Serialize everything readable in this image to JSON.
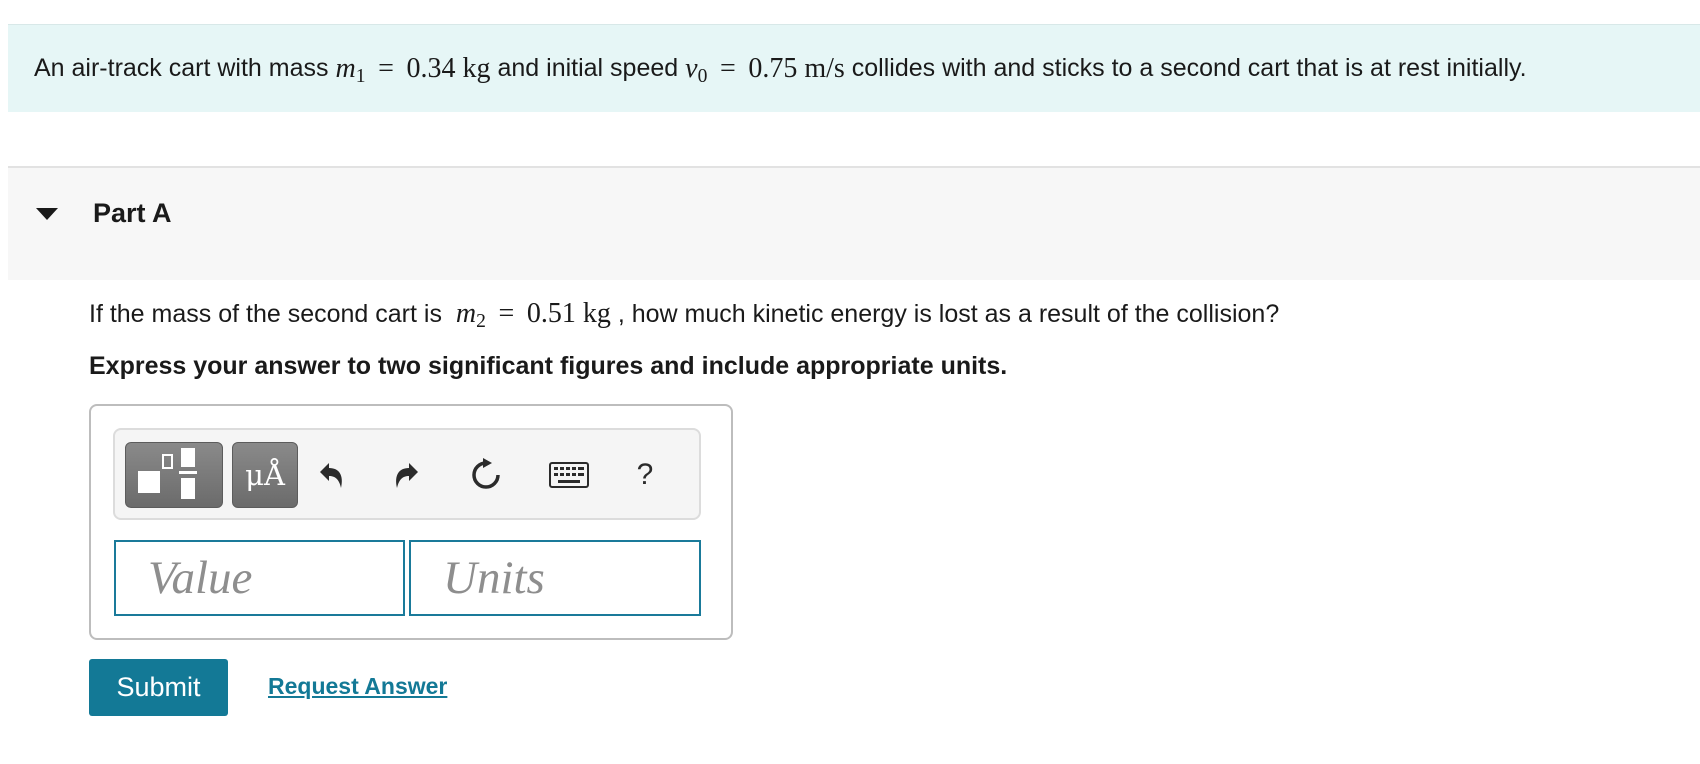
{
  "problem": {
    "intro_before_m1": "An air-track cart with mass ",
    "m1_symbol": "m",
    "m1_subscript": "1",
    "m1_value": "0.34 kg",
    "intro_mid": " and initial speed ",
    "v0_symbol": "v",
    "v0_subscript": "0",
    "v0_value": "0.75 m/s",
    "intro_after": " collides with and sticks to a second cart that is at rest initially."
  },
  "part": {
    "title": "Part A",
    "question_before": "If the mass of the second cart is ",
    "m2_symbol": "m",
    "m2_subscript": "2",
    "m2_value": "0.51 kg",
    "question_after": ", how much kinetic energy is lost as a result of the collision?",
    "instruction": "Express your answer to two significant figures and include appropriate units."
  },
  "math_common": {
    "equals": "="
  },
  "toolbar": {
    "symbols_label": "μÅ",
    "help_label": "?",
    "icons": [
      "templates-icon",
      "undo-icon",
      "redo-icon",
      "reset-icon",
      "keyboard-icon",
      "help-icon"
    ]
  },
  "answer": {
    "value_placeholder": "Value",
    "units_placeholder": "Units"
  },
  "actions": {
    "submit_label": "Submit",
    "request_label": "Request Answer"
  },
  "colors": {
    "accent": "#137996",
    "intro_background": "#e6f6f6",
    "part_background": "#f7f7f7",
    "toolbar_button": "#777777"
  }
}
